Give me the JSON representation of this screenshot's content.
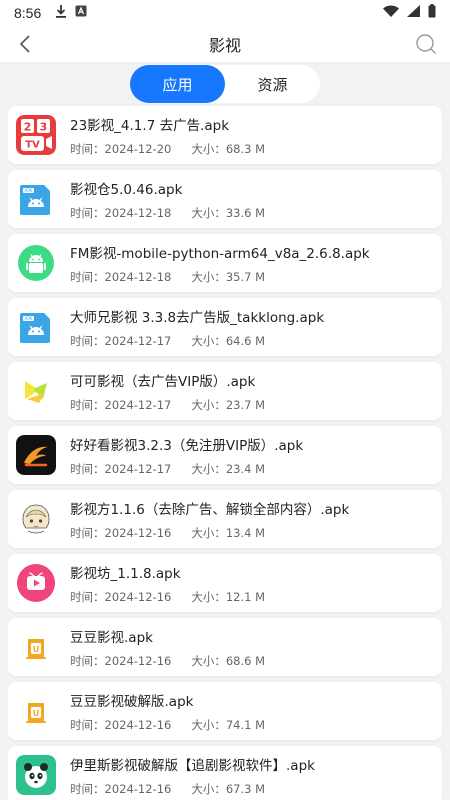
{
  "status": {
    "time": "8:56"
  },
  "header": {
    "title": "影视"
  },
  "tabs": [
    {
      "label": "应用",
      "active": true
    },
    {
      "label": "资源",
      "active": false
    }
  ],
  "meta_labels": {
    "time": "时间：",
    "size": "大小："
  },
  "files": [
    {
      "name": "23影视_4.1.7 去广告.apk",
      "date": "2024-12-20",
      "size": "68.3 M",
      "icon": "23tv-app-icon"
    },
    {
      "name": "影视仓5.0.46.apk",
      "date": "2024-12-18",
      "size": "33.6 M",
      "icon": "apk-android-icon"
    },
    {
      "name": "FM影视-mobile-python-arm64_v8a_2.6.8.apk",
      "date": "2024-12-18",
      "size": "35.7 M",
      "icon": "android-green-icon"
    },
    {
      "name": "大师兄影视 3.3.8去广告版_takklong.apk",
      "date": "2024-12-17",
      "size": "64.6 M",
      "icon": "apk-android-icon"
    },
    {
      "name": "可可影视（去广告VIP版）.apk",
      "date": "2024-12-17",
      "size": "23.7 M",
      "icon": "keke-app-icon"
    },
    {
      "name": "好好看影视3.2.3（免注册VIP版）.apk",
      "date": "2024-12-17",
      "size": "23.4 M",
      "icon": "haohaokan-app-icon"
    },
    {
      "name": "影视方1.1.6（去除广告、解锁全部内容）.apk",
      "date": "2024-12-16",
      "size": "13.4 M",
      "icon": "anime-girl-icon"
    },
    {
      "name": "影视坊_1.1.8.apk",
      "date": "2024-12-16",
      "size": "12.1 M",
      "icon": "play-pink-icon"
    },
    {
      "name": "豆豆影视.apk",
      "date": "2024-12-16",
      "size": "68.6 M",
      "icon": "doudou-app-icon"
    },
    {
      "name": "豆豆影视破解版.apk",
      "date": "2024-12-16",
      "size": "74.1 M",
      "icon": "doudou-app-icon"
    },
    {
      "name": "伊里斯影视破解版【追剧影视软件】.apk",
      "date": "2024-12-16",
      "size": "67.3 M",
      "icon": "panda-app-icon"
    }
  ],
  "colors": {
    "accent": "#1677ff",
    "background": "#f2f2f4"
  }
}
